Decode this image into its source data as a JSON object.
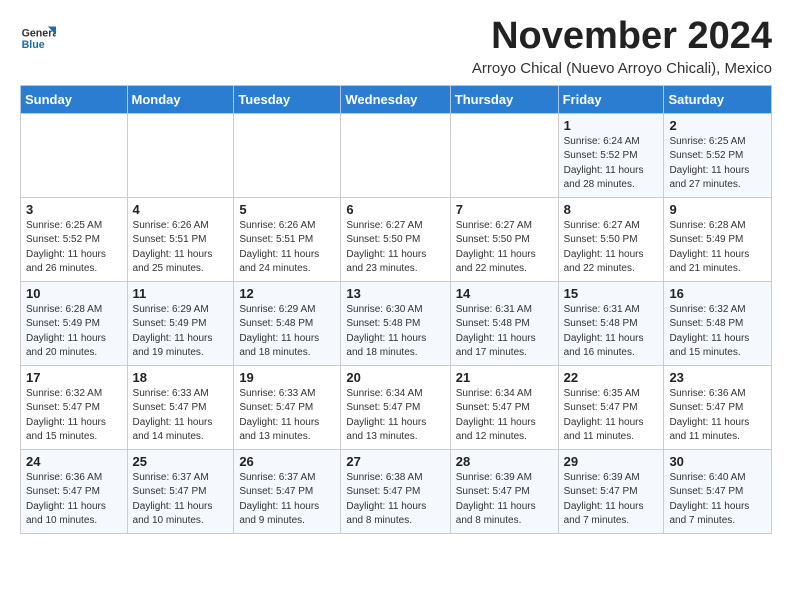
{
  "logo": {
    "line1": "General",
    "line2": "Blue"
  },
  "title": "November 2024",
  "subtitle": "Arroyo Chical (Nuevo Arroyo Chicali), Mexico",
  "days_of_week": [
    "Sunday",
    "Monday",
    "Tuesday",
    "Wednesday",
    "Thursday",
    "Friday",
    "Saturday"
  ],
  "weeks": [
    [
      {
        "day": "",
        "info": ""
      },
      {
        "day": "",
        "info": ""
      },
      {
        "day": "",
        "info": ""
      },
      {
        "day": "",
        "info": ""
      },
      {
        "day": "",
        "info": ""
      },
      {
        "day": "1",
        "info": "Sunrise: 6:24 AM\nSunset: 5:52 PM\nDaylight: 11 hours and 28 minutes."
      },
      {
        "day": "2",
        "info": "Sunrise: 6:25 AM\nSunset: 5:52 PM\nDaylight: 11 hours and 27 minutes."
      }
    ],
    [
      {
        "day": "3",
        "info": "Sunrise: 6:25 AM\nSunset: 5:52 PM\nDaylight: 11 hours and 26 minutes."
      },
      {
        "day": "4",
        "info": "Sunrise: 6:26 AM\nSunset: 5:51 PM\nDaylight: 11 hours and 25 minutes."
      },
      {
        "day": "5",
        "info": "Sunrise: 6:26 AM\nSunset: 5:51 PM\nDaylight: 11 hours and 24 minutes."
      },
      {
        "day": "6",
        "info": "Sunrise: 6:27 AM\nSunset: 5:50 PM\nDaylight: 11 hours and 23 minutes."
      },
      {
        "day": "7",
        "info": "Sunrise: 6:27 AM\nSunset: 5:50 PM\nDaylight: 11 hours and 22 minutes."
      },
      {
        "day": "8",
        "info": "Sunrise: 6:27 AM\nSunset: 5:50 PM\nDaylight: 11 hours and 22 minutes."
      },
      {
        "day": "9",
        "info": "Sunrise: 6:28 AM\nSunset: 5:49 PM\nDaylight: 11 hours and 21 minutes."
      }
    ],
    [
      {
        "day": "10",
        "info": "Sunrise: 6:28 AM\nSunset: 5:49 PM\nDaylight: 11 hours and 20 minutes."
      },
      {
        "day": "11",
        "info": "Sunrise: 6:29 AM\nSunset: 5:49 PM\nDaylight: 11 hours and 19 minutes."
      },
      {
        "day": "12",
        "info": "Sunrise: 6:29 AM\nSunset: 5:48 PM\nDaylight: 11 hours and 18 minutes."
      },
      {
        "day": "13",
        "info": "Sunrise: 6:30 AM\nSunset: 5:48 PM\nDaylight: 11 hours and 18 minutes."
      },
      {
        "day": "14",
        "info": "Sunrise: 6:31 AM\nSunset: 5:48 PM\nDaylight: 11 hours and 17 minutes."
      },
      {
        "day": "15",
        "info": "Sunrise: 6:31 AM\nSunset: 5:48 PM\nDaylight: 11 hours and 16 minutes."
      },
      {
        "day": "16",
        "info": "Sunrise: 6:32 AM\nSunset: 5:48 PM\nDaylight: 11 hours and 15 minutes."
      }
    ],
    [
      {
        "day": "17",
        "info": "Sunrise: 6:32 AM\nSunset: 5:47 PM\nDaylight: 11 hours and 15 minutes."
      },
      {
        "day": "18",
        "info": "Sunrise: 6:33 AM\nSunset: 5:47 PM\nDaylight: 11 hours and 14 minutes."
      },
      {
        "day": "19",
        "info": "Sunrise: 6:33 AM\nSunset: 5:47 PM\nDaylight: 11 hours and 13 minutes."
      },
      {
        "day": "20",
        "info": "Sunrise: 6:34 AM\nSunset: 5:47 PM\nDaylight: 11 hours and 13 minutes."
      },
      {
        "day": "21",
        "info": "Sunrise: 6:34 AM\nSunset: 5:47 PM\nDaylight: 11 hours and 12 minutes."
      },
      {
        "day": "22",
        "info": "Sunrise: 6:35 AM\nSunset: 5:47 PM\nDaylight: 11 hours and 11 minutes."
      },
      {
        "day": "23",
        "info": "Sunrise: 6:36 AM\nSunset: 5:47 PM\nDaylight: 11 hours and 11 minutes."
      }
    ],
    [
      {
        "day": "24",
        "info": "Sunrise: 6:36 AM\nSunset: 5:47 PM\nDaylight: 11 hours and 10 minutes."
      },
      {
        "day": "25",
        "info": "Sunrise: 6:37 AM\nSunset: 5:47 PM\nDaylight: 11 hours and 10 minutes."
      },
      {
        "day": "26",
        "info": "Sunrise: 6:37 AM\nSunset: 5:47 PM\nDaylight: 11 hours and 9 minutes."
      },
      {
        "day": "27",
        "info": "Sunrise: 6:38 AM\nSunset: 5:47 PM\nDaylight: 11 hours and 8 minutes."
      },
      {
        "day": "28",
        "info": "Sunrise: 6:39 AM\nSunset: 5:47 PM\nDaylight: 11 hours and 8 minutes."
      },
      {
        "day": "29",
        "info": "Sunrise: 6:39 AM\nSunset: 5:47 PM\nDaylight: 11 hours and 7 minutes."
      },
      {
        "day": "30",
        "info": "Sunrise: 6:40 AM\nSunset: 5:47 PM\nDaylight: 11 hours and 7 minutes."
      }
    ]
  ]
}
